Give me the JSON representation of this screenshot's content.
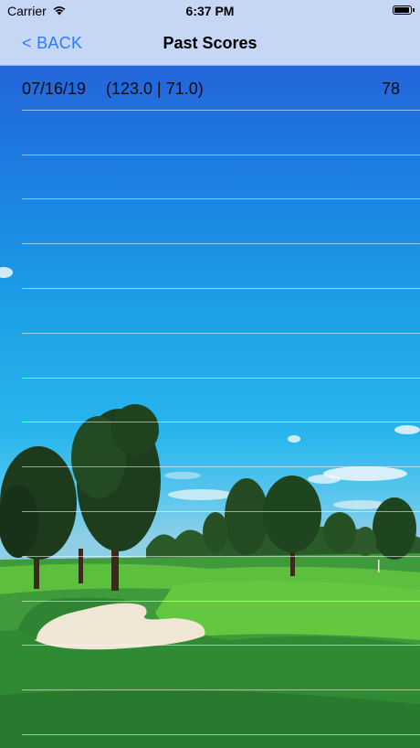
{
  "status_bar": {
    "carrier": "Carrier",
    "time": "6:37 PM",
    "wifi_icon": "wifi-icon",
    "battery_icon": "battery-icon"
  },
  "nav": {
    "back_label": "< BACK",
    "title": "Past Scores"
  },
  "scores": [
    {
      "date": "07/16/19",
      "rating": "(123.0 | 71.0)",
      "score": "78"
    },
    {
      "date": "",
      "rating": "",
      "score": ""
    },
    {
      "date": "",
      "rating": "",
      "score": ""
    },
    {
      "date": "",
      "rating": "",
      "score": ""
    },
    {
      "date": "",
      "rating": "",
      "score": ""
    },
    {
      "date": "",
      "rating": "",
      "score": ""
    },
    {
      "date": "",
      "rating": "",
      "score": ""
    },
    {
      "date": "",
      "rating": "",
      "score": ""
    },
    {
      "date": "",
      "rating": "",
      "score": ""
    },
    {
      "date": "",
      "rating": "",
      "score": ""
    },
    {
      "date": "",
      "rating": "",
      "score": ""
    },
    {
      "date": "",
      "rating": "",
      "score": ""
    },
    {
      "date": "",
      "rating": "",
      "score": ""
    },
    {
      "date": "",
      "rating": "",
      "score": ""
    },
    {
      "date": "",
      "rating": "",
      "score": ""
    }
  ],
  "colors": {
    "bar_background": "#c6d6f5",
    "link": "#2f7cf6",
    "sky_top": "#2c56d6",
    "sky_bottom": "#8fcfe6",
    "grass": "#3aa83a"
  }
}
